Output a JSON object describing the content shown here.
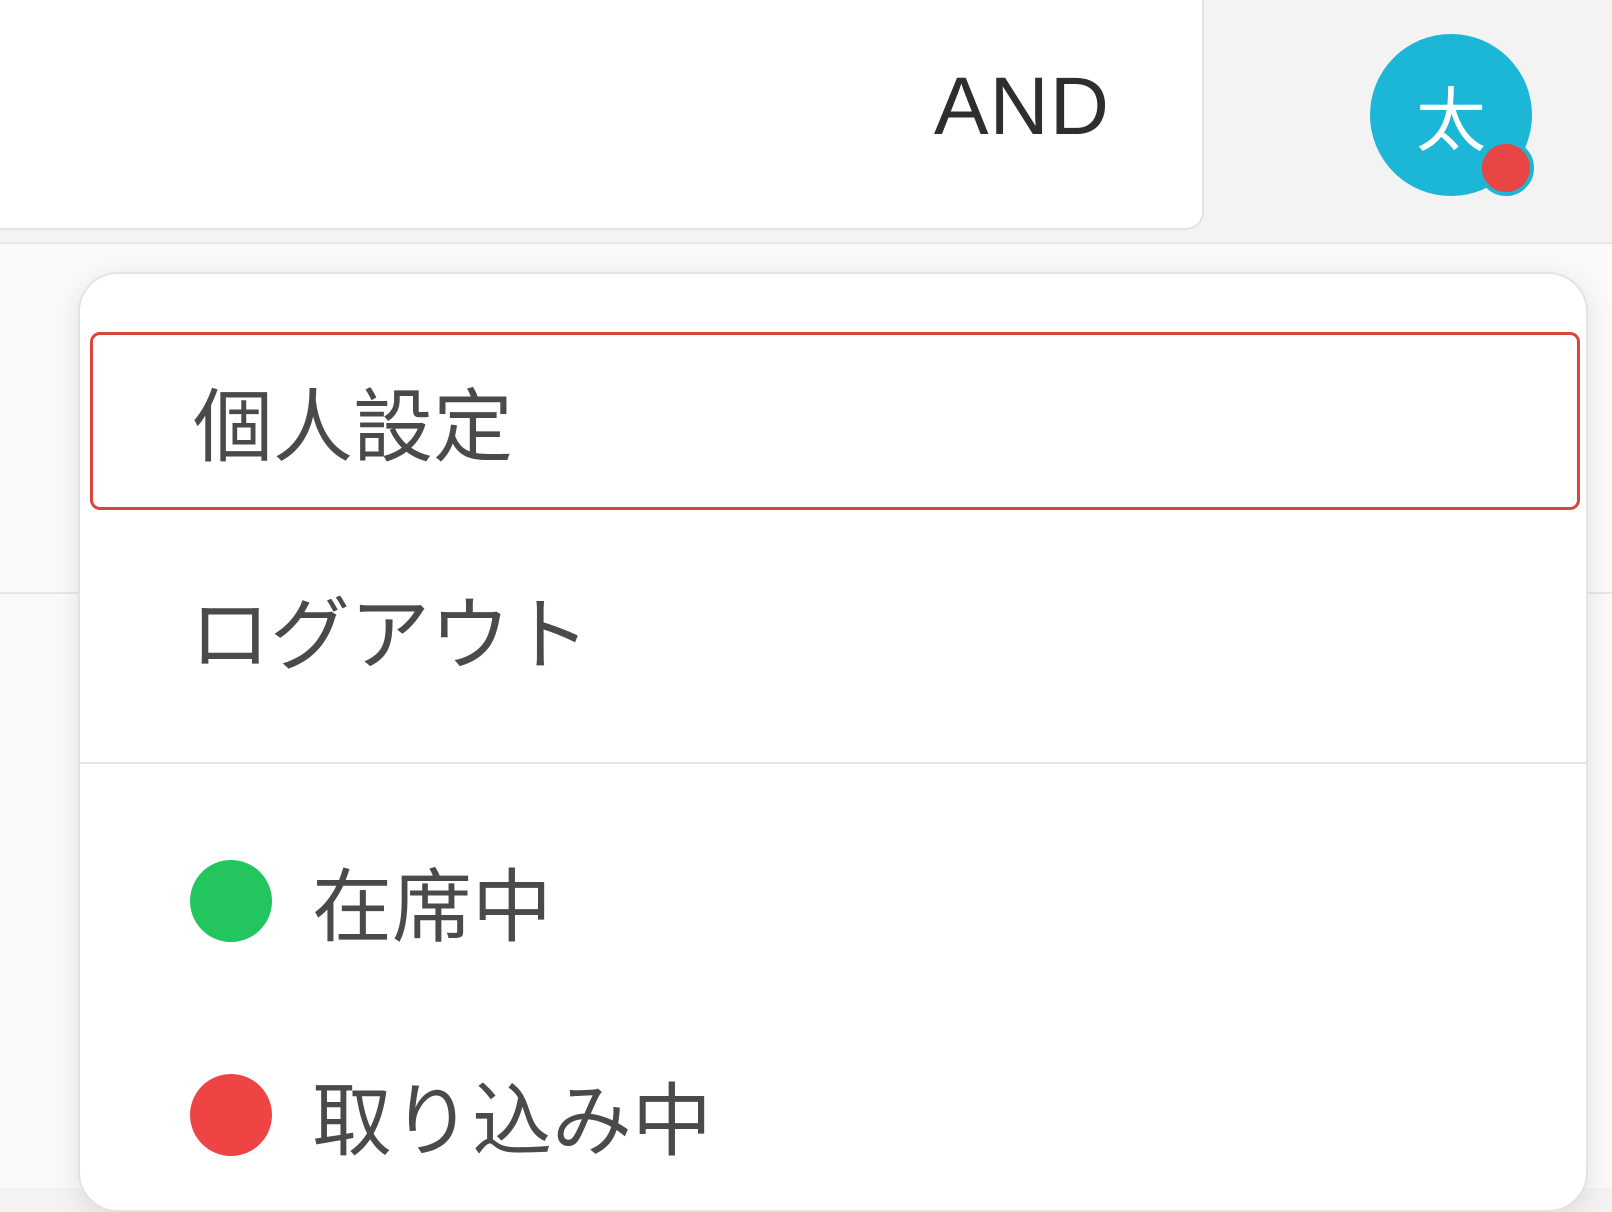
{
  "header": {
    "search_mode": "AND",
    "avatar": {
      "initial": "太",
      "color": "#1cb6d6",
      "status_dot_color": "#e84545"
    }
  },
  "dropdown": {
    "items": [
      {
        "label": "個人設定",
        "selected": true
      },
      {
        "label": "ログアウト",
        "selected": false
      }
    ],
    "statuses": [
      {
        "label": "在席中",
        "color": "#22c55e"
      },
      {
        "label": "取り込み中",
        "color": "#ef4444"
      }
    ]
  },
  "colors": {
    "selection_border": "#d9463a"
  }
}
